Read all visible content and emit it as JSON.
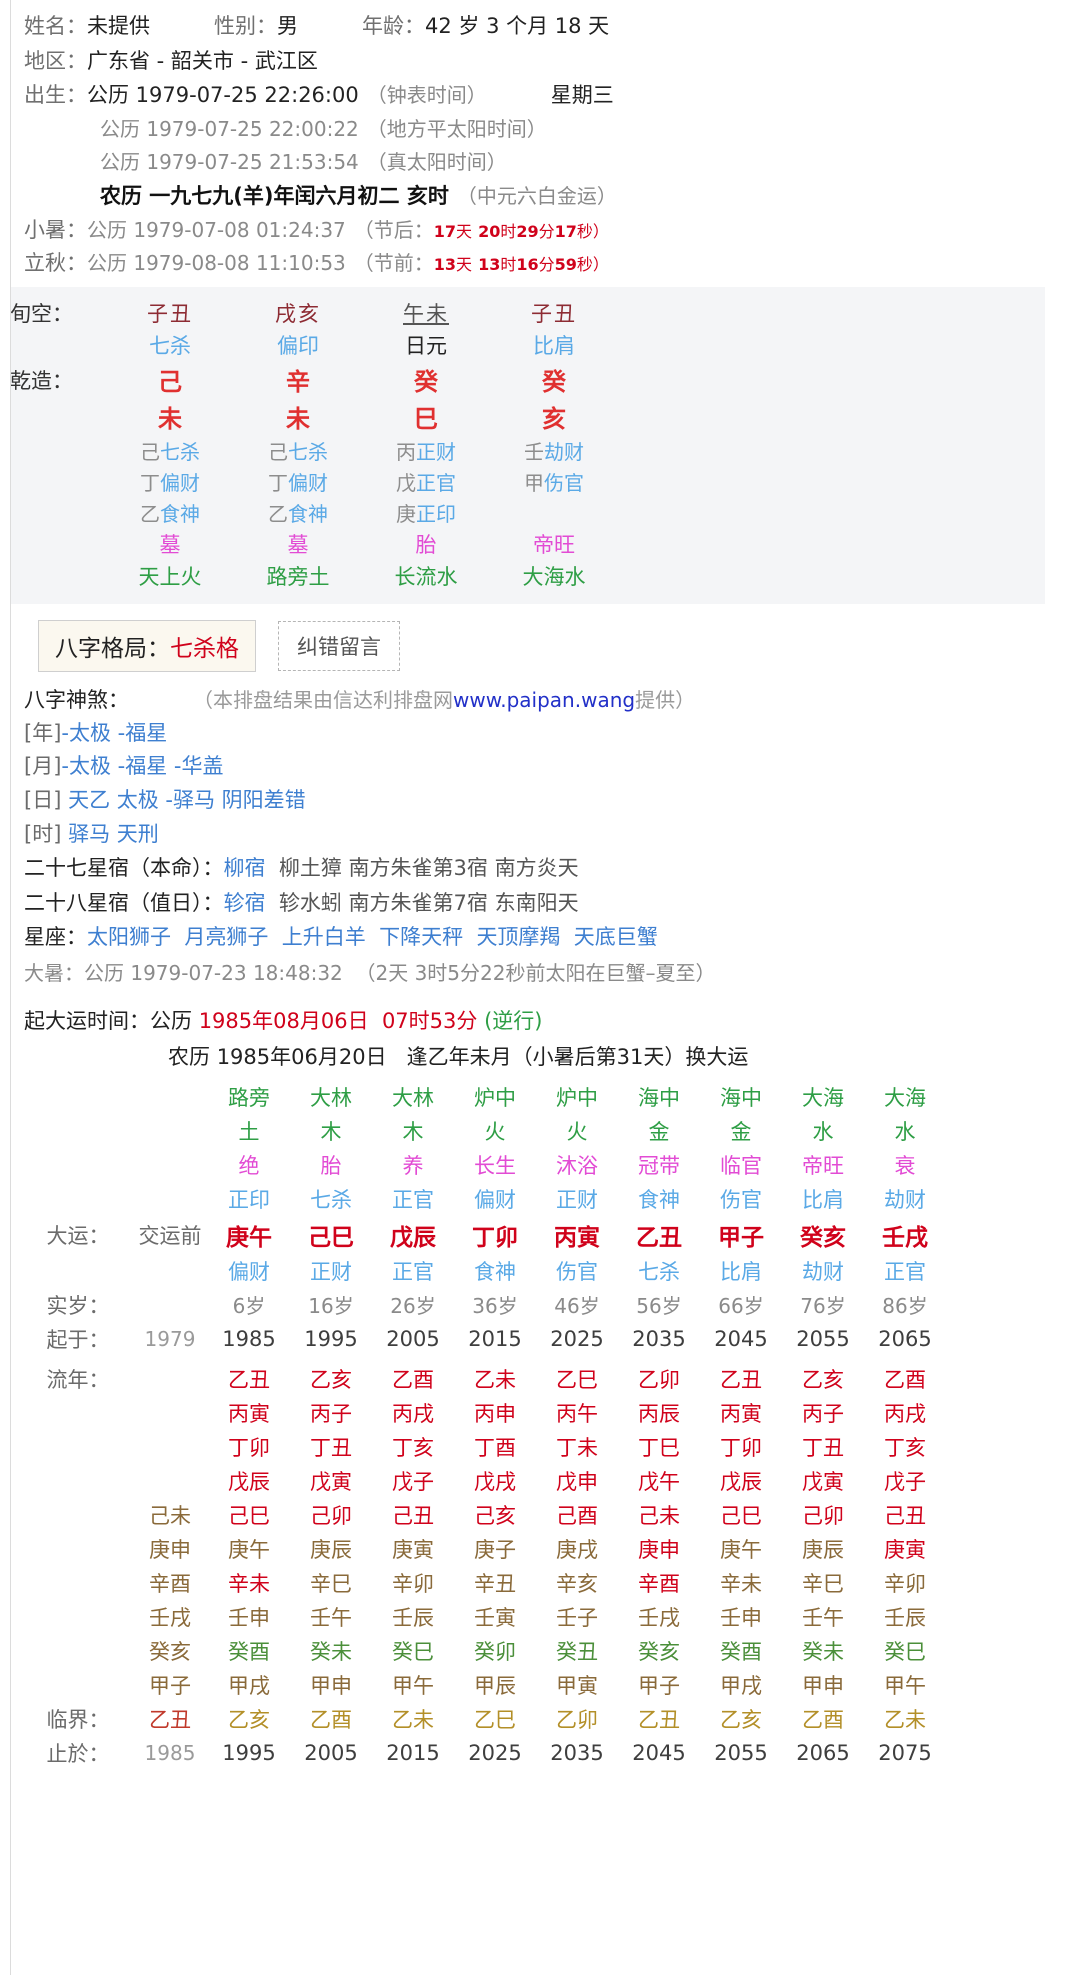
{
  "header": {
    "name_label": "姓名：",
    "name_value": "未提供",
    "gender_label": "性别：",
    "gender_value": "男",
    "age_label": "年龄：",
    "age_value": "42 岁 3 个月 18 天",
    "region_label": "地区：",
    "region_value": "广东省 - 韶关市 - 武江区",
    "birth_label": "出生：",
    "birth_solar_main": "公历 1979-07-25 22:26:00",
    "birth_solar_main_note": "（钟表时间）",
    "weekday": "星期三",
    "birth_mean_solar": "公历 1979-07-25 22:00:22",
    "birth_mean_solar_note": "（地方平太阳时间）",
    "birth_true_solar": "公历 1979-07-25 21:53:54",
    "birth_true_solar_note": "（真太阳时间）",
    "lunar": "农历 一九七九(羊)年闰六月初二 亥时",
    "lunar_note": "（中元六白金运）"
  },
  "terms": {
    "xiaoshu_label": "小暑：",
    "xiaoshu_value": "公历 1979-07-08 01:24:37",
    "xiaoshu_paren_open": "（节后：",
    "xiaoshu_d": "17",
    "xiaoshu_d_u": "天",
    "xiaoshu_h": "20",
    "xiaoshu_h_u": "时",
    "xiaoshu_m": "29",
    "xiaoshu_m_u": "分",
    "xiaoshu_s": "17",
    "xiaoshu_s_u": "秒）",
    "liqiu_label": "立秋：",
    "liqiu_value": "公历 1979-08-08 11:10:53",
    "liqiu_paren_open": "（节前：",
    "liqiu_d": "13",
    "liqiu_d_u": "天",
    "liqiu_h": "13",
    "liqiu_h_u": "时",
    "liqiu_m": "16",
    "liqiu_m_u": "分",
    "liqiu_s": "59",
    "liqiu_s_u": "秒）"
  },
  "pillars": {
    "kong_label": "旬空：",
    "qianzao_label": "乾造：",
    "kong": [
      "子丑",
      "戌亥",
      "午未",
      "子丑"
    ],
    "ten_gods": [
      "七杀",
      "偏印",
      "日元",
      "比肩"
    ],
    "gan": [
      "己",
      "辛",
      "癸",
      "癸"
    ],
    "zhi": [
      "未",
      "未",
      "巳",
      "亥"
    ],
    "hidden": [
      [
        {
          "g": "己",
          "t": "七杀"
        },
        {
          "g": "丁",
          "t": "偏财"
        },
        {
          "g": "乙",
          "t": "食神"
        }
      ],
      [
        {
          "g": "己",
          "t": "七杀"
        },
        {
          "g": "丁",
          "t": "偏财"
        },
        {
          "g": "乙",
          "t": "食神"
        }
      ],
      [
        {
          "g": "丙",
          "t": "正财"
        },
        {
          "g": "戊",
          "t": "正官"
        },
        {
          "g": "庚",
          "t": "正印"
        }
      ],
      [
        {
          "g": "壬",
          "t": "劫财"
        },
        {
          "g": "甲",
          "t": "伤官"
        }
      ]
    ],
    "stage": [
      "墓",
      "墓",
      "胎",
      "帝旺"
    ],
    "nayin": [
      "天上火",
      "路旁土",
      "长流水",
      "大海水"
    ]
  },
  "pattern": {
    "label": "八字格局：",
    "value": "七杀格",
    "fix_button": "纠错留言"
  },
  "shensha": {
    "title": "八字神煞：",
    "note": "（本排盘结果由信达利排盘网 ",
    "link": "www.paipan.wang",
    "note_end": " 提供）",
    "lines": [
      {
        "tag": "[年]",
        "items": "-太极 -福星"
      },
      {
        "tag": "[月]",
        "items": "-太极 -福星 -华盖"
      },
      {
        "tag": "[日]",
        "items": "天乙 太极 -驿马 阴阳差错"
      },
      {
        "tag": "[时]",
        "items": "驿马 天刑"
      }
    ]
  },
  "constellations": {
    "line27_label": "二十七星宿（本命）：",
    "line27_name": "柳宿",
    "line27_rest": "柳土獐    南方朱雀第3宿    南方炎天",
    "line28_label": "二十八星宿（值日）：",
    "line28_name": "轸宿",
    "line28_rest": "轸水蚓    南方朱雀第7宿    东南阳天"
  },
  "zodiac": {
    "label": "星座：",
    "items": [
      "太阳狮子",
      "月亮狮子",
      "上升白羊",
      "下降天秤",
      "天顶摩羯",
      "天底巨蟹"
    ],
    "dashu_label": "大暑：",
    "dashu_value": "公历 1979-07-23 18:48:32",
    "dashu_note": "（2天 3时5分22秒前太阳在巨蟹–夏至）"
  },
  "dayun": {
    "start_label": "起大运时间：",
    "start_prefix": "公历 ",
    "start_date": "1985年08月06日",
    "start_time": "07时53分",
    "start_dir": "(逆行)",
    "sub_prefix": "农历 ",
    "sub_date": "1985年06月20日",
    "sub_rest": "逢乙年未月（小暑后第31天）换大运",
    "row_label": "大运：",
    "pre_label": "交运前",
    "nayin_top": [
      "路旁",
      "大林",
      "大林",
      "炉中",
      "炉中",
      "海中",
      "海中",
      "大海",
      "大海"
    ],
    "nayin_bottom": [
      "土",
      "木",
      "木",
      "火",
      "火",
      "金",
      "金",
      "水",
      "水"
    ],
    "stage": [
      "绝",
      "胎",
      "养",
      "长生",
      "沐浴",
      "冠带",
      "临官",
      "帝旺",
      "衰"
    ],
    "god_top": [
      "正印",
      "七杀",
      "正官",
      "偏财",
      "正财",
      "食神",
      "伤官",
      "比肩",
      "劫财"
    ],
    "ganzhi": [
      "庚午",
      "己巳",
      "戊辰",
      "丁卯",
      "丙寅",
      "乙丑",
      "甲子",
      "癸亥",
      "壬戌"
    ],
    "god_bottom": [
      "偏财",
      "正财",
      "正官",
      "食神",
      "伤官",
      "七杀",
      "比肩",
      "劫财",
      "正官"
    ],
    "age_label": "实岁：",
    "ages": [
      "6岁",
      "16岁",
      "26岁",
      "36岁",
      "46岁",
      "56岁",
      "66岁",
      "76岁",
      "86岁"
    ],
    "from_label": "起于：",
    "from_pre": "1979",
    "from_years": [
      "1985",
      "1995",
      "2005",
      "2015",
      "2025",
      "2035",
      "2045",
      "2055",
      "2065"
    ],
    "end_label": "止於：",
    "end_pre": "1985",
    "end_years": [
      "1995",
      "2005",
      "2015",
      "2025",
      "2035",
      "2045",
      "2055",
      "2065",
      "2075"
    ]
  },
  "liunian": {
    "label": "流年：",
    "limit_label": "临界：",
    "rows": [
      {
        "pre": "",
        "cells": [
          "乙丑",
          "乙亥",
          "乙酉",
          "乙未",
          "乙巳",
          "乙卯",
          "乙丑",
          "乙亥",
          "乙酉"
        ],
        "color": "cr"
      },
      {
        "pre": "",
        "cells": [
          "丙寅",
          "丙子",
          "丙戌",
          "丙申",
          "丙午",
          "丙辰",
          "丙寅",
          "丙子",
          "丙戌"
        ],
        "color": "cr"
      },
      {
        "pre": "",
        "cells": [
          "丁卯",
          "丁丑",
          "丁亥",
          "丁酉",
          "丁未",
          "丁巳",
          "丁卯",
          "丁丑",
          "丁亥"
        ],
        "color": "cr"
      },
      {
        "pre": "",
        "cells": [
          "戊辰",
          "戊寅",
          "戊子",
          "戊戌",
          "戊申",
          "戊午",
          "戊辰",
          "戊寅",
          "戊子"
        ],
        "color": "cr"
      },
      {
        "pre": "己未",
        "cells": [
          "己巳",
          "己卯",
          "己丑",
          "己亥",
          "己酉",
          "己未",
          "己巳",
          "己卯",
          "己丑"
        ],
        "color": "cr"
      },
      {
        "pre": "庚申",
        "cells": [
          "庚午",
          "庚辰",
          "庚寅",
          "庚子",
          "庚戌",
          "庚申",
          "庚午",
          "庚辰",
          "庚寅"
        ],
        "color": "cbr"
      },
      {
        "pre": "辛酉",
        "cells": [
          "辛未",
          "辛巳",
          "辛卯",
          "辛丑",
          "辛亥",
          "辛酉",
          "辛未",
          "辛巳",
          "辛卯"
        ],
        "color": "cbr"
      },
      {
        "pre": "壬戌",
        "cells": [
          "壬申",
          "壬午",
          "壬辰",
          "壬寅",
          "壬子",
          "壬戌",
          "壬申",
          "壬午",
          "壬辰"
        ],
        "color": "cbr"
      },
      {
        "pre": "癸亥",
        "cells": [
          "癸酉",
          "癸未",
          "癸巳",
          "癸卯",
          "癸丑",
          "癸亥",
          "癸酉",
          "癸未",
          "癸巳"
        ],
        "color": "cbr"
      },
      {
        "pre": "甲子",
        "cells": [
          "甲戌",
          "甲申",
          "甲午",
          "甲辰",
          "甲寅",
          "甲子",
          "甲戌",
          "甲申",
          "甲午"
        ],
        "color": "cbr"
      }
    ],
    "limit_pre": "乙丑",
    "limit_cells": [
      "乙亥",
      "乙酉",
      "乙未",
      "乙巳",
      "乙卯",
      "乙丑",
      "乙亥",
      "乙酉",
      "乙未"
    ]
  }
}
